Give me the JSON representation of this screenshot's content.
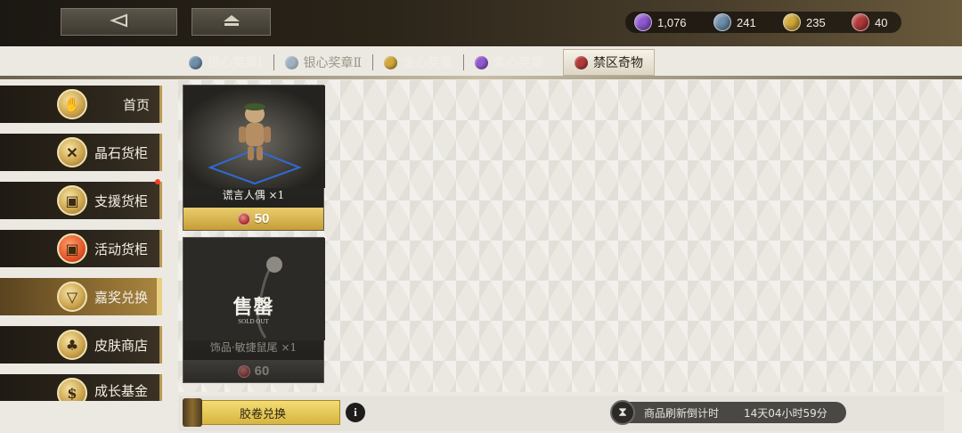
{
  "topbar": {
    "back_icon": "back-arrow-icon",
    "home_icon": "home-icon",
    "currencies": [
      {
        "icon": "purple-crystal-icon",
        "value": "1,076",
        "color": "#8f5ad1"
      },
      {
        "icon": "silver-heart-icon",
        "value": "241",
        "color": "#6f8faa"
      },
      {
        "icon": "gold-heart-icon",
        "value": "235",
        "color": "#d2a83a"
      },
      {
        "icon": "forbidden-coin-icon",
        "value": "40",
        "color": "#b33a3a"
      }
    ]
  },
  "tabs": [
    {
      "label": "银心奖章Ⅰ",
      "color": "#6f8faa",
      "state": "normal"
    },
    {
      "label": "银心奖章Ⅱ",
      "color": "#6f8faa",
      "state": "dim"
    },
    {
      "label": "金心奖章",
      "color": "#d2a83a",
      "state": "normal"
    },
    {
      "label": "紫心奖章",
      "color": "#8f5ad1",
      "state": "normal"
    },
    {
      "label": "禁区奇物",
      "color": "#b33a3a",
      "state": "active"
    }
  ],
  "sidebar": {
    "items": [
      {
        "label": "首页"
      },
      {
        "label": "晶石货柜"
      },
      {
        "label": "支援货柜"
      },
      {
        "label": "活动货柜"
      },
      {
        "label": "嘉奖兑换"
      },
      {
        "label": "皮肤商店"
      },
      {
        "label": "成长基金"
      }
    ]
  },
  "products": [
    {
      "name": "谎言人偶 ×1",
      "price": "50",
      "sold_out": false
    },
    {
      "name": "饰品·敏捷鼠尾 ×1",
      "price": "60",
      "sold_out": true,
      "soldout_text": "售罄",
      "soldout_sub": "SOLD OUT"
    }
  ],
  "bottom": {
    "exchange_label": "胶卷兑换",
    "info_label": "i",
    "timer_label": "商品刷新倒计时",
    "timer_value": "14天04小时59分"
  }
}
